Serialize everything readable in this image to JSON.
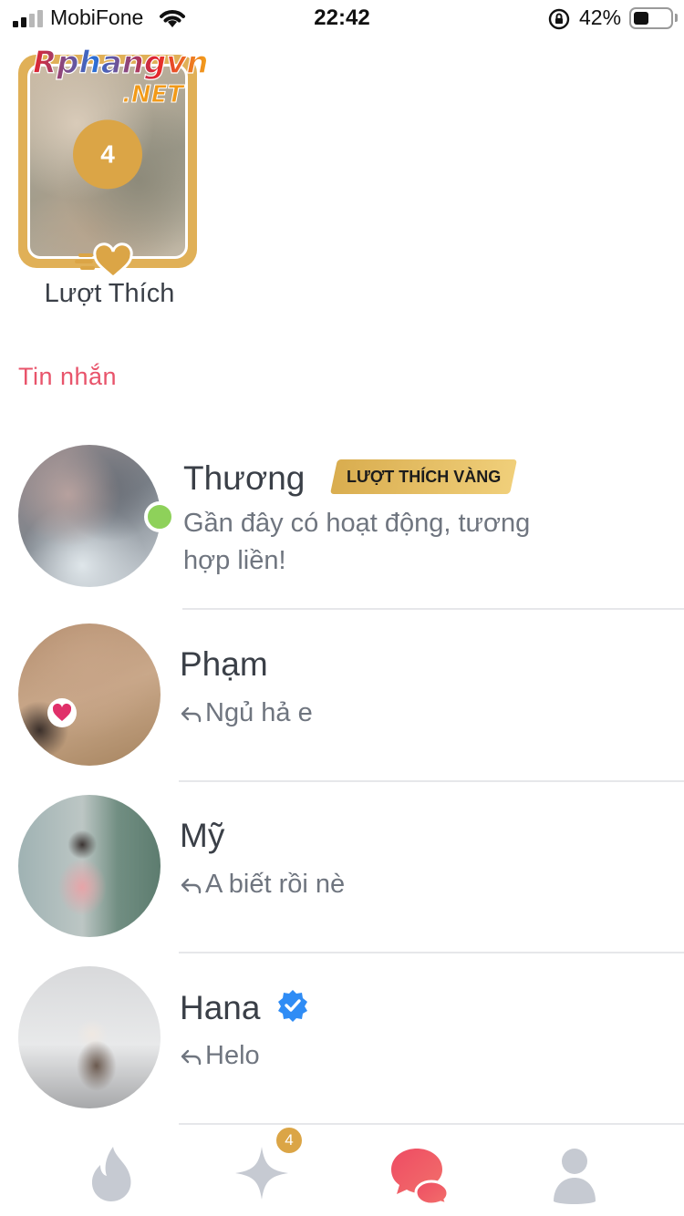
{
  "status_bar": {
    "carrier": "MobiFone",
    "time": "22:42",
    "battery_percent": "42%",
    "battery_level": 0.42,
    "signal_bars": 2
  },
  "watermark": {
    "text": "Rphangvn",
    "suffix": ".NET"
  },
  "likes": {
    "count": "4",
    "label": "Lượt Thích"
  },
  "messages": {
    "section_title": "Tin nhắn",
    "items": [
      {
        "name": "Thương",
        "badge": "LƯỢT THÍCH VÀNG",
        "preview_line1": "Gần đây có hoạt động, tương",
        "preview_line2": "hợp liền!",
        "online": true
      },
      {
        "name": "Phạm",
        "preview": "Ngủ hả e",
        "replied": true
      },
      {
        "name": "Mỹ",
        "preview": "A biết rồi nè",
        "replied": true
      },
      {
        "name": "Hana",
        "preview": "Helo",
        "replied": true,
        "verified": true
      }
    ]
  },
  "tab_bar": {
    "tabs": [
      {
        "icon": "flame-icon",
        "active": false
      },
      {
        "icon": "sparkle-icon",
        "active": false,
        "badge": "4"
      },
      {
        "icon": "chat-bubbles-icon",
        "active": true
      },
      {
        "icon": "profile-icon",
        "active": false
      }
    ]
  },
  "colors": {
    "accent": "#e8546b",
    "gold": "#dba546",
    "online": "#8ed15a",
    "inactive_icon": "#c6cad2"
  }
}
